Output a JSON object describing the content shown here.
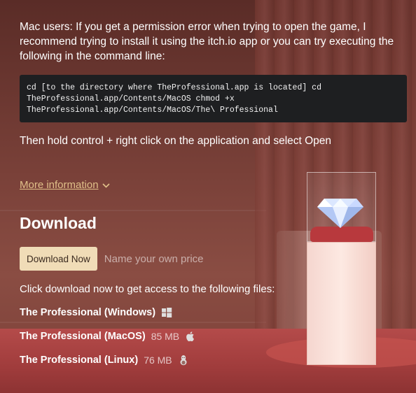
{
  "instructions": {
    "mac_note": "Mac users: If you get a permission error when trying to open the game, I recommend trying to install it using the itch.io app or you can try executing the following in the command line:",
    "command": "cd [to the directory where TheProfessional.app is located] cd TheProfessional.app/Contents/MacOS chmod +x TheProfessional.app/Contents/MacOS/The\\ Professional",
    "after_note": "Then hold control + right click on the application and select Open"
  },
  "more_info": {
    "label": "More information",
    "icon": "chevron-down-icon"
  },
  "download": {
    "title": "Download",
    "button_label": "Download Now",
    "price_label": "Name your own price",
    "files_intro": "Click download now to get access to the following files:",
    "files": [
      {
        "name": "The Professional (Windows)",
        "size": "",
        "os_icon": "windows-icon"
      },
      {
        "name": "The Professional (MacOS)",
        "size": "85 MB",
        "os_icon": "apple-icon"
      },
      {
        "name": "The Professional (Linux)",
        "size": "76 MB",
        "os_icon": "linux-icon"
      }
    ]
  },
  "colors": {
    "accent_link": "#e0c089",
    "button_bg": "#f0dcb7",
    "code_bg": "#1e1f21"
  }
}
